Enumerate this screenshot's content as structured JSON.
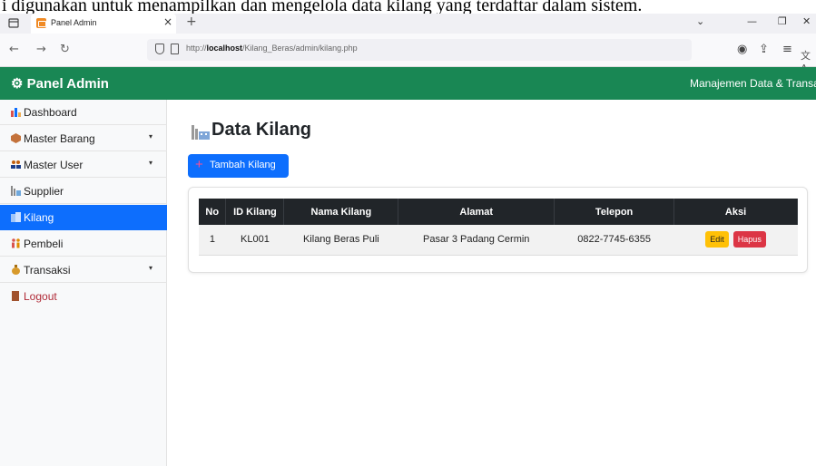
{
  "caption": "i digunakan untuk menampilkan dan mengelola data kilang yang terdaftar dalam sistem.",
  "browser": {
    "tab_title": "Panel Admin",
    "tab_close": "×",
    "new_tab": "+",
    "url_prefix": "http://",
    "url_host": "localhost",
    "url_path": "/Kilang_Beras/admin/kilang.php"
  },
  "header": {
    "brand": "Panel Admin",
    "brand_icon": "⚙",
    "right_text": "Manajemen Data & Transaksi"
  },
  "sidebar": {
    "items": [
      {
        "label": "Dashboard",
        "icon": "bar-chart-icon",
        "has_caret": false
      },
      {
        "label": "Master Barang",
        "icon": "box-icon",
        "has_caret": true
      },
      {
        "label": "Master User",
        "icon": "users-icon",
        "has_caret": true
      },
      {
        "label": "Supplier",
        "icon": "factory-icon",
        "has_caret": false
      },
      {
        "label": "Kilang",
        "icon": "building-icon",
        "has_caret": false,
        "active": true
      },
      {
        "label": "Pembeli",
        "icon": "people-icon",
        "has_caret": false
      },
      {
        "label": "Transaksi",
        "icon": "money-bag-icon",
        "has_caret": true
      },
      {
        "label": "Logout",
        "icon": "door-icon",
        "has_caret": false
      }
    ],
    "caret": "▾"
  },
  "main": {
    "title": "Data Kilang",
    "add_button": "Tambah Kilang",
    "table": {
      "headers": [
        "No",
        "ID Kilang",
        "Nama Kilang",
        "Alamat",
        "Telepon",
        "Aksi"
      ],
      "rows": [
        {
          "no": "1",
          "id": "KL001",
          "nama": "Kilang Beras Puli",
          "alamat": "Pasar 3 Padang Cermin",
          "telepon": "0822-7745-6355",
          "edit": "Edit",
          "hapus": "Hapus"
        }
      ]
    }
  },
  "colors": {
    "header_green": "#198754",
    "active_blue": "#0d6efd",
    "edit_yellow": "#ffc107",
    "delete_red": "#dc3545",
    "table_head": "#212529"
  }
}
